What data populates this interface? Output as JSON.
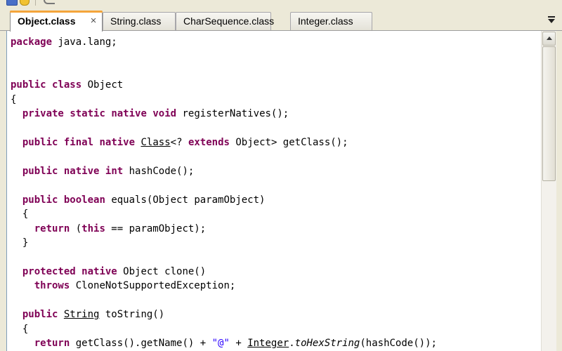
{
  "tabs": [
    {
      "label": "Object.class",
      "active": true
    },
    {
      "label": "String.class",
      "active": false
    },
    {
      "label": "CharSequence.class",
      "active": false
    },
    {
      "label": "Integer.class",
      "active": false
    }
  ],
  "tab_close_glyph": "×",
  "code_lines": [
    [
      {
        "t": "package",
        "s": "kw"
      },
      {
        "t": " java.lang;"
      }
    ],
    [],
    [],
    [
      {
        "t": "public",
        "s": "kw"
      },
      {
        "t": " "
      },
      {
        "t": "class",
        "s": "kw"
      },
      {
        "t": " Object"
      }
    ],
    [
      {
        "t": "{"
      }
    ],
    [
      {
        "t": "  "
      },
      {
        "t": "private",
        "s": "kw"
      },
      {
        "t": " "
      },
      {
        "t": "static",
        "s": "kw"
      },
      {
        "t": " "
      },
      {
        "t": "native",
        "s": "kw"
      },
      {
        "t": " "
      },
      {
        "t": "void",
        "s": "kw"
      },
      {
        "t": " registerNatives();"
      }
    ],
    [],
    [
      {
        "t": "  "
      },
      {
        "t": "public",
        "s": "kw"
      },
      {
        "t": " "
      },
      {
        "t": "final",
        "s": "kw"
      },
      {
        "t": " "
      },
      {
        "t": "native",
        "s": "kw"
      },
      {
        "t": " "
      },
      {
        "t": "Class",
        "s": "ul"
      },
      {
        "t": "<? "
      },
      {
        "t": "extends",
        "s": "kw"
      },
      {
        "t": " Object> getClass();"
      }
    ],
    [],
    [
      {
        "t": "  "
      },
      {
        "t": "public",
        "s": "kw"
      },
      {
        "t": " "
      },
      {
        "t": "native",
        "s": "kw"
      },
      {
        "t": " "
      },
      {
        "t": "int",
        "s": "kw"
      },
      {
        "t": " hashCode();"
      }
    ],
    [],
    [
      {
        "t": "  "
      },
      {
        "t": "public",
        "s": "kw"
      },
      {
        "t": " "
      },
      {
        "t": "boolean",
        "s": "kw"
      },
      {
        "t": " equals(Object paramObject)"
      }
    ],
    [
      {
        "t": "  {"
      }
    ],
    [
      {
        "t": "    "
      },
      {
        "t": "return",
        "s": "kw"
      },
      {
        "t": " ("
      },
      {
        "t": "this",
        "s": "kw"
      },
      {
        "t": " == paramObject);"
      }
    ],
    [
      {
        "t": "  }"
      }
    ],
    [],
    [
      {
        "t": "  "
      },
      {
        "t": "protected",
        "s": "kw"
      },
      {
        "t": " "
      },
      {
        "t": "native",
        "s": "kw"
      },
      {
        "t": " Object clone()"
      }
    ],
    [
      {
        "t": "    "
      },
      {
        "t": "throws",
        "s": "kw"
      },
      {
        "t": " CloneNotSupportedException;"
      }
    ],
    [],
    [
      {
        "t": "  "
      },
      {
        "t": "public",
        "s": "kw"
      },
      {
        "t": " "
      },
      {
        "t": "String",
        "s": "ul"
      },
      {
        "t": " toString()"
      }
    ],
    [
      {
        "t": "  {"
      }
    ],
    [
      {
        "t": "    "
      },
      {
        "t": "return",
        "s": "kw"
      },
      {
        "t": " getClass().getName() + "
      },
      {
        "t": "\"@\"",
        "s": "str"
      },
      {
        "t": " + "
      },
      {
        "t": "Integer",
        "s": "ul"
      },
      {
        "t": "."
      },
      {
        "t": "toHexString",
        "s": "it"
      },
      {
        "t": "(hashCode());"
      }
    ]
  ]
}
